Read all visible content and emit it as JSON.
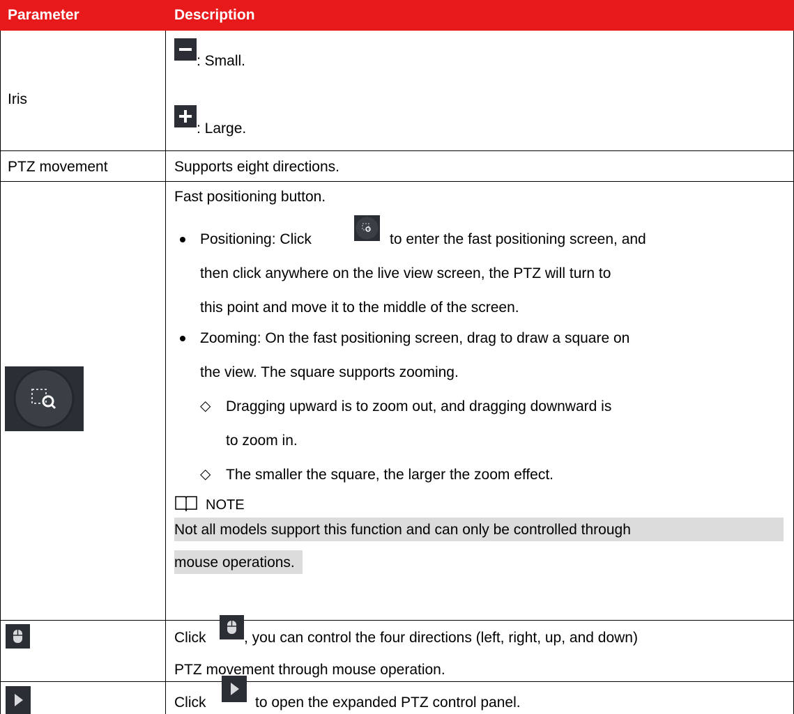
{
  "table": {
    "headers": [
      "Parameter",
      "Description"
    ],
    "header_color": "#e8191a",
    "rows": [
      {
        "param": "Iris",
        "lines": [
          ": Small.",
          ": Large."
        ],
        "icons": [
          "minus-icon",
          "plus-icon"
        ]
      },
      {
        "param": "PTZ movement",
        "lines": [
          "Supports eight directions."
        ]
      },
      {
        "param_icon": "fast-positioning-icon",
        "intro": "Fast positioning button.",
        "bullet1": {
          "before": "Positioning: Click",
          "after": "to enter the fast positioning screen, and",
          "cont": [
            "then click anywhere on the live view screen, the PTZ will turn to",
            "this point and move it to the middle of the screen."
          ]
        },
        "bullet2": {
          "lines": [
            "Zooming: On the fast positioning screen, drag to draw a square on",
            "the view. The square supports zooming."
          ],
          "subs": [
            [
              "Dragging upward is to zoom out, and dragging downward is",
              "to zoom in."
            ],
            [
              "The smaller the square, the larger the zoom effect."
            ]
          ]
        },
        "note_label": "NOTE",
        "note_lines": [
          "Not all models support this function and can only be controlled through",
          "mouse operations."
        ]
      },
      {
        "param_icon": "mouse-icon",
        "before": "Click",
        "after": ", you can control the four directions (left, right, up, and down)",
        "cont": "PTZ movement through mouse operation."
      },
      {
        "param_icon": "expand-arrow-icon",
        "before": "Click",
        "after": "to open the expanded PTZ control panel."
      }
    ]
  }
}
